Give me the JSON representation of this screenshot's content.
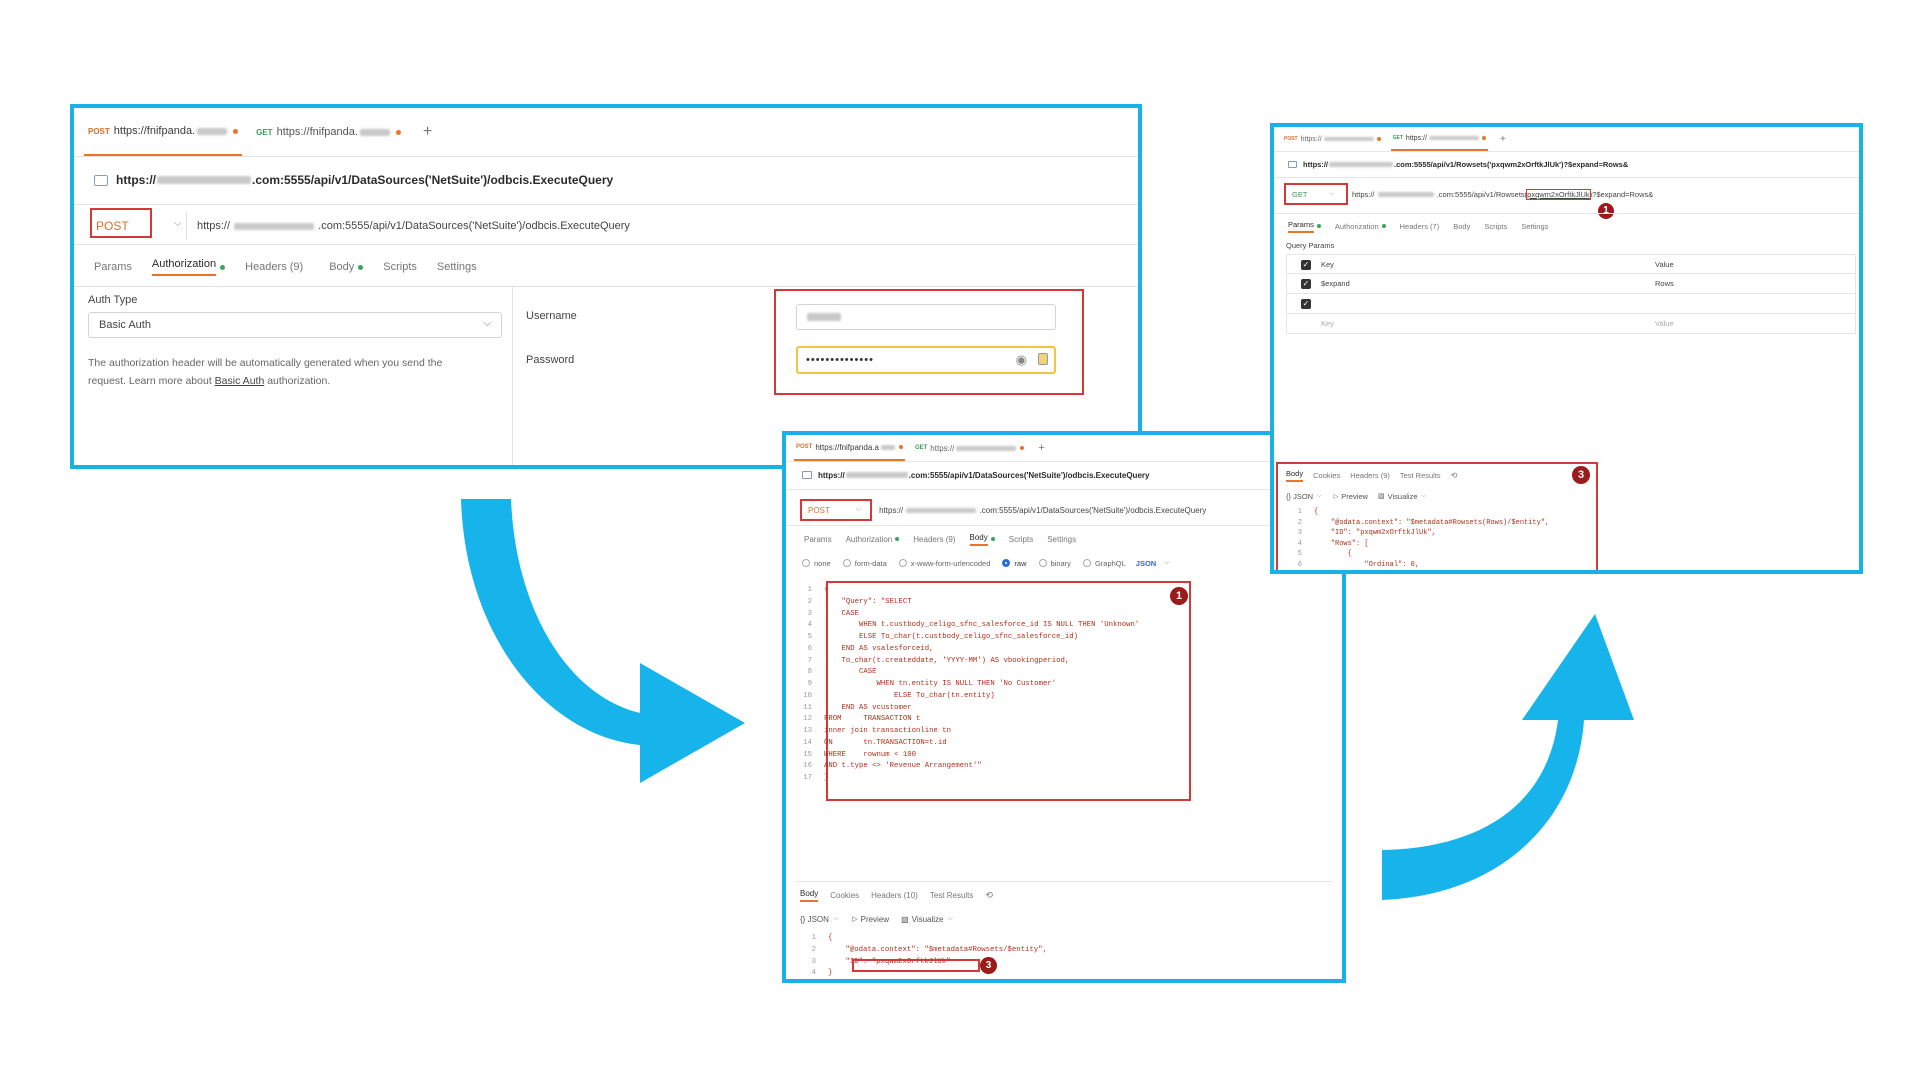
{
  "colors": {
    "frame": "#1ab0e8",
    "highlight": "#d23a3a",
    "badge": "#9b1a1a",
    "post": "#d8702c",
    "get": "#3a9c5c",
    "arrow": "#17b4ec"
  },
  "icons": [
    "url-icon",
    "chevron-down-icon",
    "eye-icon",
    "lock-icon",
    "history-icon",
    "play-icon",
    "chart-icon",
    "plus-icon",
    "check-icon",
    "radio-icon"
  ],
  "panel1": {
    "tabs": [
      {
        "method": "POST",
        "url": "https://fnifpanda."
      },
      {
        "method": "GET",
        "url": "https://fnifpanda."
      }
    ],
    "new_tab": "+",
    "title_prefix": "https://",
    "title_suffix": ".com:5555/api/v1/DataSources('NetSuite')/odbcis.ExecuteQuery",
    "method": "POST",
    "url_prefix": "https://",
    "url_suffix": ".com:5555/api/v1/DataSources('NetSuite')/odbcis.ExecuteQuery",
    "subtabs": [
      "Params",
      "Authorization",
      "Headers (9)",
      "Body",
      "Scripts",
      "Settings"
    ],
    "auth_type_label": "Auth Type",
    "auth_type_value": "Basic Auth",
    "auth_note_1": "The authorization header will be automatically generated when you send the",
    "auth_note_2_pre": "request. Learn more about ",
    "auth_note_link": "Basic Auth",
    "auth_note_2_post": " authorization.",
    "username_label": "Username",
    "password_label": "Password",
    "password_value": "••••••••••••••"
  },
  "panel2": {
    "tabs": [
      {
        "method": "POST",
        "url": "https://fnifpanda.a"
      },
      {
        "method": "GET",
        "url": "https://"
      }
    ],
    "new_tab": "+",
    "title_prefix": "https://",
    "title_suffix": ".com:5555/api/v1/DataSources('NetSuite')/odbcis.ExecuteQuery",
    "method": "POST",
    "url_prefix": "https://",
    "url_suffix": ".com:5555/api/v1/DataSources('NetSuite')/odbcis.ExecuteQuery",
    "subtabs": [
      "Params",
      "Authorization",
      "Headers (9)",
      "Body",
      "Scripts",
      "Settings"
    ],
    "body_types": [
      "none",
      "form-data",
      "x-www-form-urlencoded",
      "raw",
      "binary",
      "GraphQL"
    ],
    "body_format": "JSON",
    "code": [
      "{",
      "    \"Query\": \"SELECT",
      "    CASE",
      "        WHEN t.custbody_celigo_sfnc_salesforce_id IS NULL THEN 'Unknown'",
      "        ELSE To_char(t.custbody_celigo_sfnc_salesforce_id)",
      "    END AS vsalesforceid,",
      "    To_char(t.createddate, 'YYYY-MM') AS vbookingperiod,",
      "        CASE",
      "            WHEN tn.entity IS NULL THEN 'No Customer'",
      "                ELSE To_char(tn.entity)",
      "    END AS vcustomer",
      "FROM     TRANSACTION t",
      "inner join transactionline tn",
      "ON       tn.TRANSACTION=t.id",
      "WHERE    rownum < 100",
      "AND t.type <> 'Revenue Arrangement'\"",
      "}"
    ],
    "response_tabs": [
      "Body",
      "Cookies",
      "Headers (10)",
      "Test Results"
    ],
    "response_format": "{} JSON",
    "preview": "Preview",
    "visualize": "Visualize",
    "response_lines": [
      "{",
      "    \"@odata.context\": \"$metadata#Rowsets/$entity\",",
      "    \"ID\": \"pxqwm2xOrftkJlUk\"",
      "}"
    ],
    "badge_1": "1",
    "badge_3": "3"
  },
  "panel3": {
    "tabs": [
      {
        "method": "POST",
        "url": "https://"
      },
      {
        "method": "GET",
        "url": "https://"
      }
    ],
    "new_tab": "+",
    "title_prefix": "https://",
    "title_suffix": ".com:5555/api/v1/Rowsets('pxqwm2xOrftkJlUk')?$expand=Rows&",
    "method": "GET",
    "url_prefix": "https://",
    "url_mid": ".com:5555/api/v1/Rowsets(",
    "url_id": "pxqwm2xOrftkJlUk",
    "url_suffix": ")?$expand=Rows&",
    "subtabs": [
      "Params",
      "Authorization",
      "Headers (7)",
      "Body",
      "Scripts",
      "Settings"
    ],
    "query_params_label": "Query Params",
    "params_header": {
      "key": "Key",
      "value": "Value"
    },
    "params": [
      {
        "key": "$expand",
        "value": "Rows"
      }
    ],
    "params_placeholder": {
      "key": "Key",
      "value": "Value"
    },
    "response_tabs": [
      "Body",
      "Cookies",
      "Headers (9)",
      "Test Results"
    ],
    "response_format": "{} JSON",
    "preview": "Preview",
    "visualize": "Visualize",
    "response_lines": [
      "{",
      "    \"@odata.context\": \"$metadata#Rowsets(Rows)/$entity\",",
      "    \"ID\": \"pxqwm2xOrftkJlUk\",",
      "    \"Rows\": [",
      "        {",
      "            \"Ordinal\": 0,"
    ],
    "badge_1": "1",
    "badge_3": "3"
  }
}
